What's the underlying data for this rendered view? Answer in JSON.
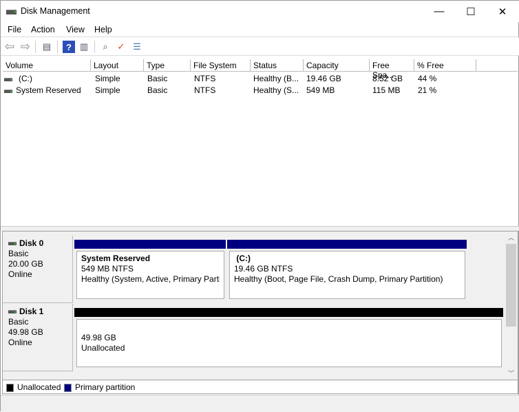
{
  "window": {
    "title": "Disk Management",
    "minimize": "—",
    "maximize": "☐",
    "close": "✕"
  },
  "menu": [
    "File",
    "Action",
    "View",
    "Help"
  ],
  "toolbar": [
    {
      "name": "back-icon",
      "g": "⇦"
    },
    {
      "name": "forward-icon",
      "g": "⇨"
    },
    {
      "name": "show-hide-console-tree-icon",
      "g": "▤"
    },
    {
      "name": "help-icon",
      "g": "?"
    },
    {
      "name": "show-action-pane-icon",
      "g": "▥"
    },
    {
      "name": "connect-drive-icon",
      "g": "⌕"
    },
    {
      "name": "properties-check-icon",
      "g": "✓"
    },
    {
      "name": "list-icon",
      "g": "☰"
    }
  ],
  "columns": [
    "Volume",
    "Layout",
    "Type",
    "File System",
    "Status",
    "Capacity",
    "Free Spa...",
    "% Free"
  ],
  "volumes": [
    [
      "(C:)",
      "Simple",
      "Basic",
      "NTFS",
      "Healthy (B...",
      "19.46 GB",
      "8.52 GB",
      "44 %"
    ],
    [
      "System Reserved",
      "Simple",
      "Basic",
      "NTFS",
      "Healthy (S...",
      "549 MB",
      "115 MB",
      "21 %"
    ]
  ],
  "disks": [
    {
      "name": "Disk 0",
      "type": "Basic",
      "size": "20.00 GB",
      "state": "Online",
      "partitions": [
        {
          "title": "System Reserved",
          "size": "549 MB NTFS",
          "status": "Healthy (System, Active, Primary Partiti"
        },
        {
          "title": " (C:)",
          "size": "19.46 GB NTFS",
          "status": "Healthy (Boot, Page File, Crash Dump, Primary Partition)"
        }
      ]
    },
    {
      "name": "Disk 1",
      "type": "Basic",
      "size": "49.98 GB",
      "state": "Online",
      "partitions": [
        {
          "size": "49.98 GB",
          "status": "Unallocated"
        }
      ]
    }
  ],
  "legend": [
    {
      "label": "Unallocated",
      "color": "#000000"
    },
    {
      "label": "Primary partition",
      "color": "#000080"
    }
  ],
  "colors": {
    "primary": "#000080",
    "unallocated": "#000000"
  }
}
